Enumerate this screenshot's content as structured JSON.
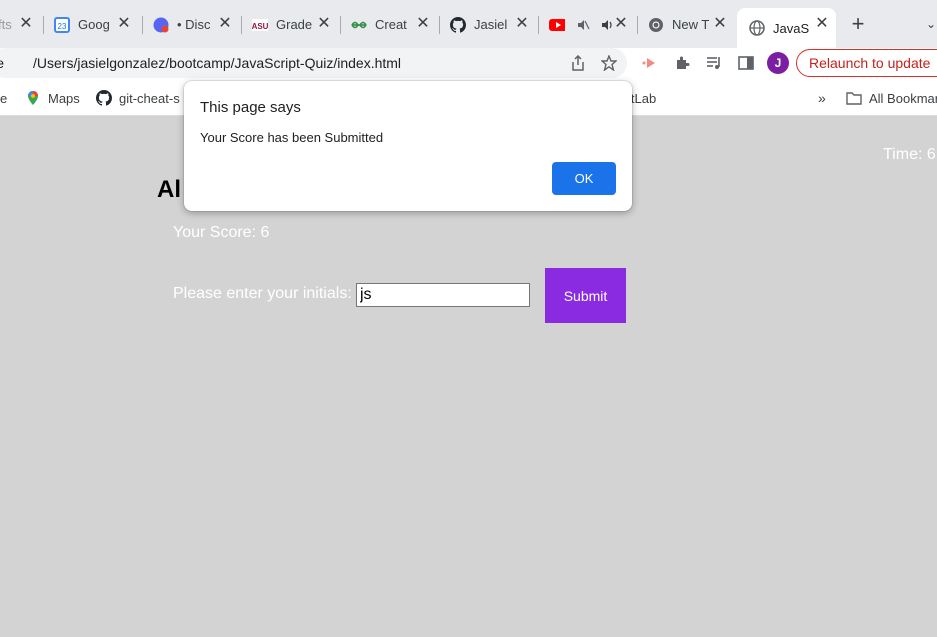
{
  "tabs": [
    {
      "title": "fts",
      "icon": "generic-page-icon"
    },
    {
      "title": "Goog",
      "icon": "google-calendar-icon"
    },
    {
      "title": "• Disc",
      "icon": "discord-icon"
    },
    {
      "title": "Grade",
      "icon": "asu-icon"
    },
    {
      "title": "Creat",
      "icon": "geeksforgeeks-icon"
    },
    {
      "title": "Jasiel",
      "icon": "github-icon"
    },
    {
      "title": "",
      "icon": "youtube-icon"
    },
    {
      "title": "New T",
      "icon": "chrome-icon"
    },
    {
      "title": "JavaS",
      "icon": "globe-icon",
      "active": true
    }
  ],
  "toolbar": {
    "omni_prefix": "ile",
    "url": "/Users/jasielgonzalez/bootcamp/JavaScript-Quiz/index.html",
    "avatar_letter": "J",
    "relaunch_label": "Relaunch to update"
  },
  "bookmarks": {
    "items": [
      {
        "label": "e",
        "icon": ""
      },
      {
        "label": "Maps",
        "icon": "maps-icon"
      },
      {
        "label": "git-cheat-s",
        "icon": "github-icon"
      },
      {
        "label": "itLab",
        "icon": ""
      }
    ],
    "overflow": "»",
    "all_label": "All Bookmar"
  },
  "page": {
    "timer": "Time: 6",
    "heading": "Al",
    "score": "Your Score: 6",
    "initials_label": "Please enter your initials:",
    "initials_value": "js",
    "submit_label": "Submit"
  },
  "dialog": {
    "title": "This page says",
    "message": "Your Score has been Submitted",
    "ok_label": "OK"
  },
  "colors": {
    "page_bg": "#d3d3d3",
    "submit_bg": "#8a2be2",
    "ok_bg": "#1a73e8",
    "relaunch": "#c5221f"
  }
}
